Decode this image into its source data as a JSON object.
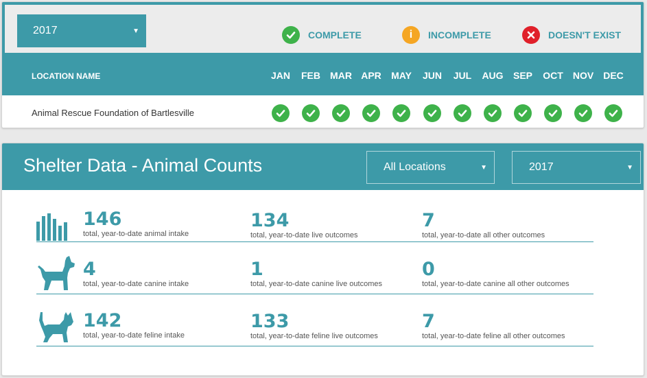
{
  "status": {
    "year_select": "2017",
    "legend": {
      "complete": "COMPLETE",
      "incomplete": "INCOMPLETE",
      "doesnt_exist": "DOESN'T EXIST"
    },
    "location_header": "LOCATION NAME",
    "months": [
      "JAN",
      "FEB",
      "MAR",
      "APR",
      "MAY",
      "JUN",
      "JUL",
      "AUG",
      "SEP",
      "OCT",
      "NOV",
      "DEC"
    ],
    "rows": [
      {
        "location": "Animal Rescue Foundation of Bartlesville",
        "statuses": [
          "complete",
          "complete",
          "complete",
          "complete",
          "complete",
          "complete",
          "complete",
          "complete",
          "complete",
          "complete",
          "complete",
          "complete"
        ]
      }
    ]
  },
  "shelter": {
    "title": "Shelter Data - Animal Counts",
    "location_select": "All Locations",
    "year_select": "2017",
    "rows": [
      {
        "icon": "bar-chart-icon",
        "stats": [
          {
            "value": "146",
            "label": "total, year-to-date animal intake"
          },
          {
            "value": "134",
            "label": "total, year-to-date live outcomes"
          },
          {
            "value": "7",
            "label": "total, year-to-date all other outcomes"
          }
        ]
      },
      {
        "icon": "dog-icon",
        "stats": [
          {
            "value": "4",
            "label": "total, year-to-date canine intake"
          },
          {
            "value": "1",
            "label": "total, year-to-date canine live outcomes"
          },
          {
            "value": "0",
            "label": "total, year-to-date canine all other outcomes"
          }
        ]
      },
      {
        "icon": "cat-icon",
        "stats": [
          {
            "value": "142",
            "label": "total, year-to-date feline intake"
          },
          {
            "value": "133",
            "label": "total, year-to-date feline live outcomes"
          },
          {
            "value": "7",
            "label": "total, year-to-date feline all other outcomes"
          }
        ]
      }
    ]
  },
  "colors": {
    "accent": "#3d9aa8",
    "complete": "#3eb24a",
    "incomplete": "#f5a623",
    "doesnt_exist": "#e0202a"
  }
}
